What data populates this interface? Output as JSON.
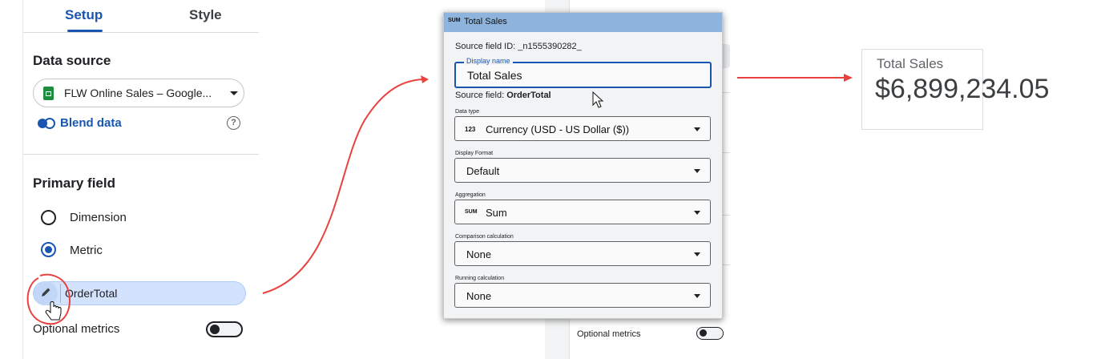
{
  "left_panel": {
    "tabs": [
      {
        "label": "Setup",
        "active": true
      },
      {
        "label": "Style",
        "active": false
      }
    ],
    "data_source": {
      "title": "Data source",
      "selected": "FLW Online Sales – Google...",
      "source_icon": "google-sheets-icon",
      "blend_label": "Blend data",
      "help_glyph": "?"
    },
    "primary_field": {
      "title": "Primary field",
      "options": [
        {
          "label": "Dimension",
          "selected": false
        },
        {
          "label": "Metric",
          "selected": true
        }
      ],
      "metric_chip": "OrderTotal"
    },
    "optional_metrics": {
      "label": "Optional metrics",
      "enabled": false
    }
  },
  "background_panel": {
    "optional_metrics_label": "Optional metrics"
  },
  "dialog": {
    "badge": "SUM",
    "title": "Total Sales",
    "source_field_id": "Source field ID: _n1555390282_",
    "display_name": {
      "caption": "Display name",
      "value": "Total Sales"
    },
    "source_field": {
      "prefix": "Source field: ",
      "value": "OrderTotal"
    },
    "fields": [
      {
        "caption": "Data type",
        "prefix": "123",
        "value": "Currency (USD - US Dollar ($))"
      },
      {
        "caption": "Display Format",
        "prefix": "",
        "value": "Default"
      },
      {
        "caption": "Aggregation",
        "prefix": "SUM",
        "value": "Sum"
      },
      {
        "caption": "Comparison calculation",
        "prefix": "",
        "value": "None"
      },
      {
        "caption": "Running calculation",
        "prefix": "",
        "value": "None"
      }
    ]
  },
  "scorecard": {
    "title": "Total Sales",
    "value": "$6,899,234.05"
  },
  "colors": {
    "accent": "#1a56b0",
    "annotation_red": "#e8423f",
    "dialog_header": "#8eb4de"
  }
}
